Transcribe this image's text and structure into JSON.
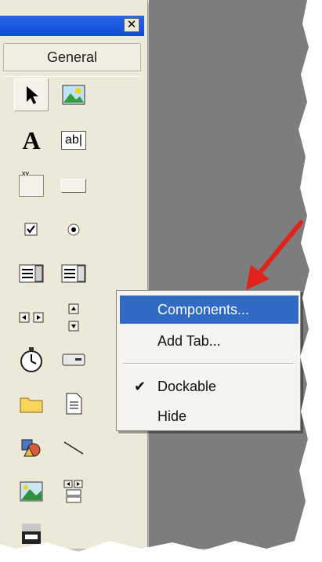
{
  "toolbox": {
    "close_glyph": "✕",
    "tab_label": "General",
    "tools": [
      "pointer-icon",
      "picturebox-icon",
      "label-icon",
      "textbox-icon",
      "frame-icon",
      "commandbutton-icon",
      "checkbox-icon",
      "optionbutton-icon",
      "combobox-icon",
      "listbox-icon",
      "hscrollbar-icon",
      "vscrollbar-icon",
      "timer-icon",
      "drivelistbox-icon",
      "dirlistbox-icon",
      "filelistbox-icon",
      "shape-icon",
      "line-icon",
      "image-icon",
      "data-icon",
      "ole-icon"
    ],
    "textbox_text": "ab|",
    "label_text": "A",
    "frame_text": "xv"
  },
  "context_menu": {
    "items": [
      {
        "label": "Components...",
        "highlighted": true
      },
      {
        "label": "Add Tab...",
        "highlighted": false
      },
      {
        "label": "Dockable",
        "checked": true
      },
      {
        "label": "Hide",
        "highlighted": false
      }
    ],
    "check_glyph": "✔"
  },
  "colors": {
    "titlebar": "#0a4bd5",
    "highlight": "#316ac5",
    "workspace": "#7d7d7d",
    "arrow": "#e0241b"
  }
}
